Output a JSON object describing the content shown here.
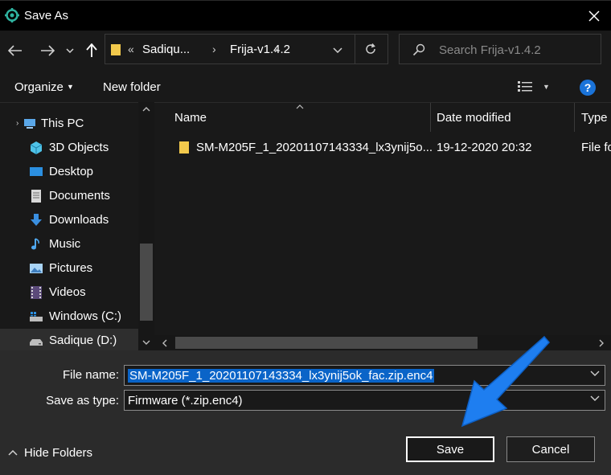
{
  "window": {
    "title": "Save As",
    "close_icon": "close-icon"
  },
  "address": {
    "overflow": "«",
    "crumbs": [
      "Sadiqu...",
      "Frija-v1.4.2"
    ],
    "search_placeholder": "Search Frija-v1.4.2"
  },
  "toolbar": {
    "organize": "Organize",
    "new_folder": "New folder",
    "help": "?"
  },
  "nav": {
    "items": [
      {
        "label": "This PC",
        "icon": "pc-icon"
      },
      {
        "label": "3D Objects",
        "icon": "cube-icon"
      },
      {
        "label": "Desktop",
        "icon": "desktop-icon"
      },
      {
        "label": "Documents",
        "icon": "documents-icon"
      },
      {
        "label": "Downloads",
        "icon": "downloads-icon"
      },
      {
        "label": "Music",
        "icon": "music-icon"
      },
      {
        "label": "Pictures",
        "icon": "pictures-icon"
      },
      {
        "label": "Videos",
        "icon": "videos-icon"
      },
      {
        "label": "Windows (C:)",
        "icon": "drive-icon"
      },
      {
        "label": "Sadique (D:)",
        "icon": "drive-icon"
      }
    ]
  },
  "filelist": {
    "columns": {
      "name": "Name",
      "date": "Date modified",
      "type": "Type"
    },
    "rows": [
      {
        "name": "SM-M205F_1_20201107143334_lx3ynij5o...",
        "date": "19-12-2020 20:32",
        "type": "File fo"
      }
    ]
  },
  "form": {
    "filename_label": "File name:",
    "filename_value": "SM-M205F_1_20201107143334_lx3ynij5ok_fac.zip.enc4",
    "type_label": "Save as type:",
    "type_value": "Firmware (*.zip.enc4)"
  },
  "footer": {
    "hide_folders": "Hide Folders",
    "save": "Save",
    "cancel": "Cancel"
  },
  "colors": {
    "accent": "#0a64c8",
    "arrow": "#1e7ef0",
    "folder": "#f2c94c"
  }
}
